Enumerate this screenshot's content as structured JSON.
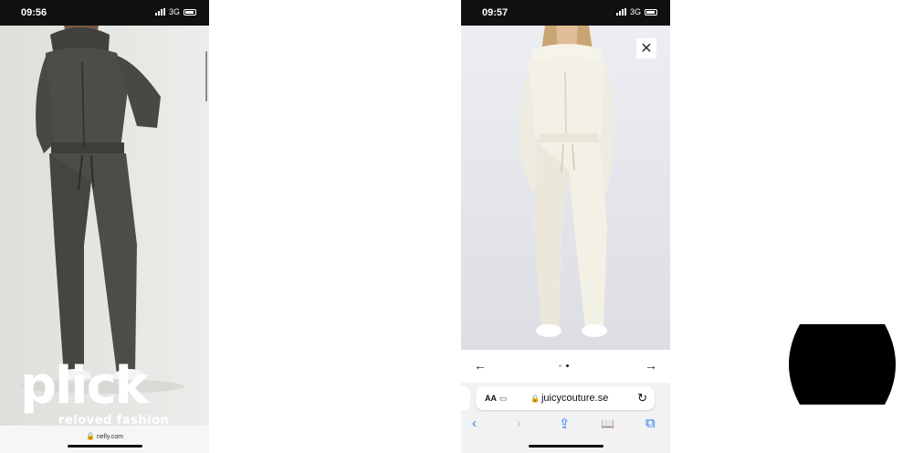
{
  "left_screen": {
    "status": {
      "time": "09:56",
      "network": "3G"
    },
    "watermark": {
      "word": "plick",
      "tagline": "reloved fashion"
    },
    "url": "nelly.com"
  },
  "right_screen": {
    "status": {
      "time": "09:57",
      "network": "3G"
    },
    "close_label": "✕",
    "carousel": {
      "prev": "←",
      "next": "→",
      "page_count": 2,
      "active_index": 1
    },
    "safari": {
      "text_size_label": "AA",
      "url": "juicycouture.se",
      "reload_icon": "↻",
      "toolbar": {
        "back": "‹",
        "forward": "›",
        "share": "⇪",
        "bookmarks": "📖",
        "tabs": "⧉"
      }
    }
  },
  "colors": {
    "left_suit": "#4b4d47",
    "right_suit": "#f3f0e6",
    "safari_blue": "#2f7bf6"
  }
}
